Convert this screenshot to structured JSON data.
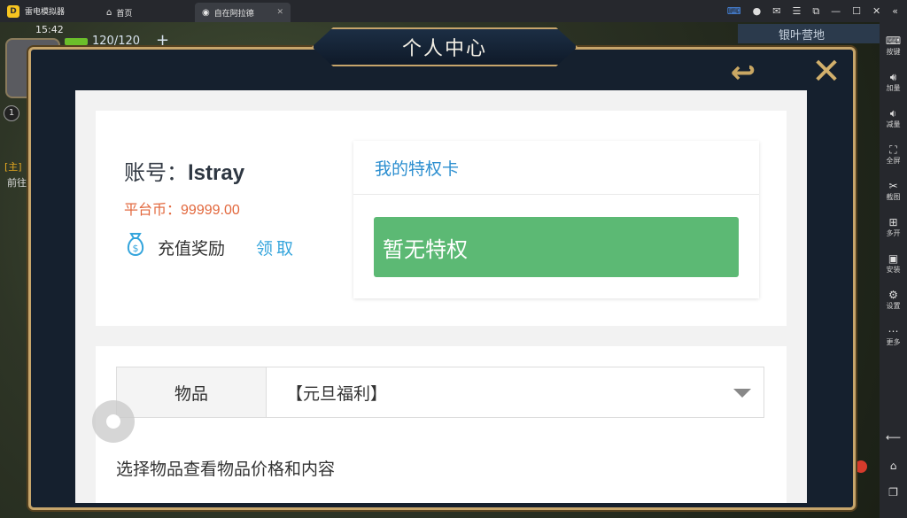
{
  "emulator": {
    "app_name": "雷电模拟器",
    "tabs": [
      {
        "label": "首页",
        "icon": "home-icon"
      },
      {
        "label": "自在阿拉德",
        "icon": "game-tab-icon",
        "close": "✕"
      }
    ],
    "window_controls": [
      "gamepad-icon",
      "user-icon",
      "mail-icon",
      "menu-icon",
      "restore-icon",
      "minimize-icon",
      "maximize-icon",
      "close-icon",
      "collapse-icon"
    ],
    "sidebar": [
      {
        "label": "按键",
        "icon": "keyboard-icon"
      },
      {
        "label": "加量",
        "icon": "volume-up-icon"
      },
      {
        "label": "减量",
        "icon": "volume-down-icon"
      },
      {
        "label": "全屏",
        "icon": "fullscreen-icon"
      },
      {
        "label": "截图",
        "icon": "screenshot-icon"
      },
      {
        "label": "多开",
        "icon": "multi-instance-icon"
      },
      {
        "label": "安装",
        "icon": "apk-install-icon"
      },
      {
        "label": "设置",
        "icon": "settings-icon"
      },
      {
        "label": "更多",
        "icon": "more-icon"
      }
    ],
    "nav_buttons": [
      "back-icon",
      "home-icon",
      "recent-apps-icon"
    ]
  },
  "game_hud": {
    "time": "15:42",
    "energy": "120/120",
    "energy_plus": "+",
    "level": "1",
    "location": "银叶营地",
    "quest_tag": "[主]",
    "quest_text": "前往"
  },
  "modal": {
    "title": "个人中心",
    "back_label": "↩",
    "close_label": "✕"
  },
  "account": {
    "account_prefix": "账号：",
    "username": "lstray",
    "coins_label": "平台币：",
    "coins_value": "99999.00",
    "reward_label": "充值奖励",
    "claim_label": "领取"
  },
  "privilege": {
    "header": "我的特权卡",
    "empty_text": "暂无特权"
  },
  "items": {
    "label": "物品",
    "selected": "【元旦福利】",
    "hint": "选择物品查看物品价格和内容"
  },
  "colors": {
    "modal_border": "#c6a56b",
    "coins": "#e2673c",
    "link": "#35a5dc",
    "privilege_empty_bg": "#5cb974"
  }
}
